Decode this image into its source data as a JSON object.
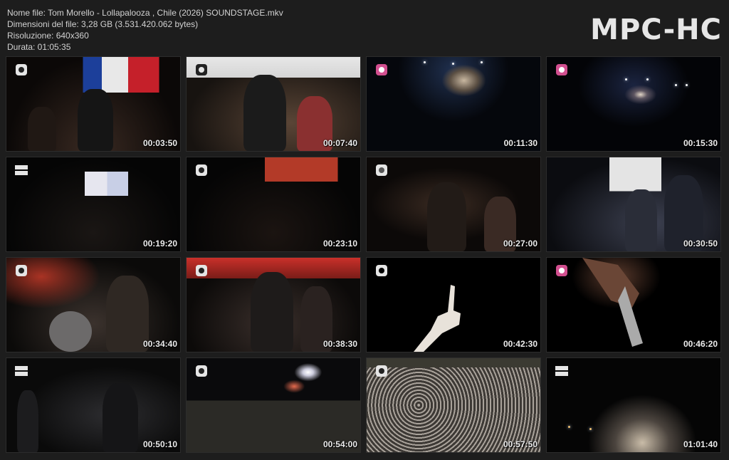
{
  "info": {
    "filename_line": "Nome file: Tom Morello - Lollapalooza , Chile (2026) SOUNDSTAGE.mkv",
    "filesize_line": "Dimensioni del file: 3,28 GB (3.531.420.062 bytes)",
    "resolution_line": "Risoluzione: 640x360",
    "duration_line": "Durata: 01:05:35"
  },
  "brand": "MPC-HC",
  "thumbnails": [
    {
      "time": "00:03:50",
      "logo": "lollapalooza-icon"
    },
    {
      "time": "00:07:40",
      "logo": "lollapalooza-icon"
    },
    {
      "time": "00:11:30",
      "logo": "lollapalooza-icon"
    },
    {
      "time": "00:15:30",
      "logo": "lollapalooza-icon"
    },
    {
      "time": "00:19:20",
      "logo": "alternative-icon"
    },
    {
      "time": "00:23:10",
      "logo": "lollapalooza-icon"
    },
    {
      "time": "00:27:00",
      "logo": "lollapalooza-icon"
    },
    {
      "time": "00:30:50",
      "logo": "none"
    },
    {
      "time": "00:34:40",
      "logo": "lollapalooza-icon"
    },
    {
      "time": "00:38:30",
      "logo": "lollapalooza-icon"
    },
    {
      "time": "00:42:30",
      "logo": "lollapalooza-icon"
    },
    {
      "time": "00:46:20",
      "logo": "lollapalooza-icon"
    },
    {
      "time": "00:50:10",
      "logo": "alternative-icon"
    },
    {
      "time": "00:54:00",
      "logo": "lollapalooza-icon"
    },
    {
      "time": "00:57:50",
      "logo": "lollapalooza-icon"
    },
    {
      "time": "01:01:40",
      "logo": "alternative-icon"
    }
  ]
}
